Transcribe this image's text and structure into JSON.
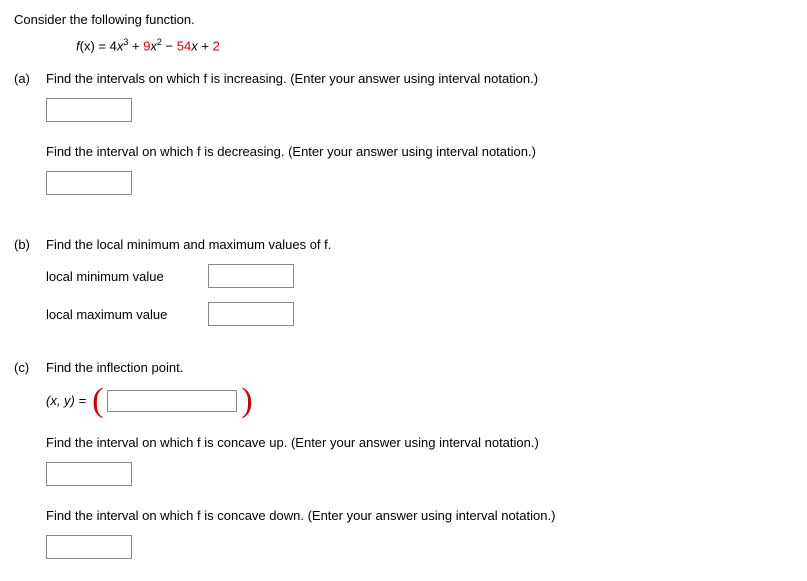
{
  "intro": "Consider the following function.",
  "formula": {
    "fx": "f",
    "of": "(x) = 4",
    "x3_var": "x",
    "x3_exp": "3",
    "plus1": " + ",
    "c9": "9",
    "x2_var": "x",
    "x2_exp": "2",
    "minus": " − ",
    "c54": "54",
    "xv": "x",
    "plus2": " + ",
    "c2": "2"
  },
  "a": {
    "label": "(a)",
    "prompt1": "Find the intervals on which f is increasing. (Enter your answer using interval notation.)",
    "prompt2": "Find the interval on which f is decreasing. (Enter your answer using interval notation.)"
  },
  "b": {
    "label": "(b)",
    "prompt": "Find the local minimum and maximum values of f.",
    "min_label": "local minimum value",
    "max_label": "local maximum value"
  },
  "c": {
    "label": "(c)",
    "prompt1": "Find the inflection point.",
    "xy": "(x, y) = ",
    "prompt2": "Find the interval on which f is concave up. (Enter your answer using interval notation.)",
    "prompt3": "Find the interval on which f is concave down. (Enter your answer using interval notation.)"
  }
}
